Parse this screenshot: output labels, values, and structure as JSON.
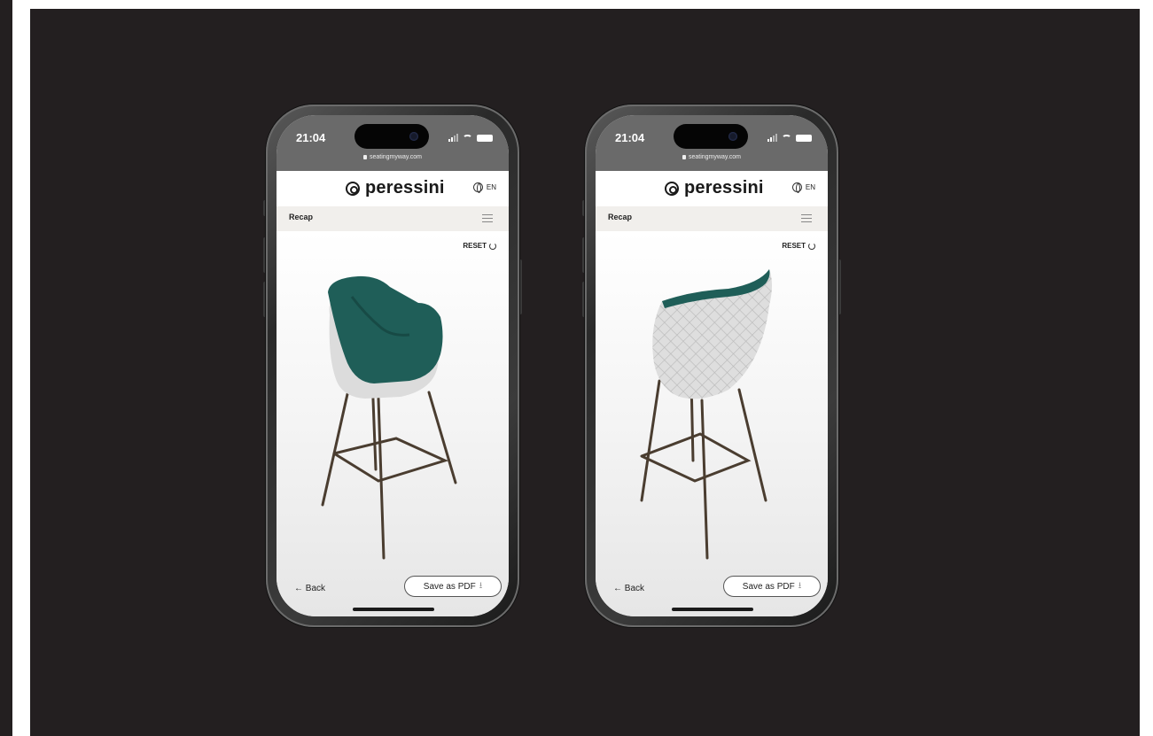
{
  "phones": [
    {
      "status": {
        "time": "21:04",
        "url": "seatingmyway.com"
      },
      "header": {
        "logo_text": "peressini",
        "language": "EN"
      },
      "recap": {
        "label": "Recap"
      },
      "viewer": {
        "reset_label": "RESET",
        "view": "front",
        "colors": {
          "shell": "#1f5e58",
          "back": "#dcdcdc",
          "legs": "#4a3d30"
        }
      },
      "footer": {
        "back_label": "← Back",
        "pdf_label": "Save as PDF"
      }
    },
    {
      "status": {
        "time": "21:04",
        "url": "seatingmyway.com"
      },
      "header": {
        "logo_text": "peressini",
        "language": "EN"
      },
      "recap": {
        "label": "Recap"
      },
      "viewer": {
        "reset_label": "RESET",
        "view": "back",
        "colors": {
          "shell": "#1f5e58",
          "back": "#dcdcdc",
          "legs": "#4a3d30"
        }
      },
      "footer": {
        "back_label": "← Back",
        "pdf_label": "Save as PDF"
      }
    }
  ],
  "icons": [
    "signal-icon",
    "wifi-icon",
    "battery-icon",
    "lock-icon",
    "globe-icon",
    "sliders-icon",
    "reset-icon",
    "download-icon",
    "peressini-logo-icon"
  ]
}
